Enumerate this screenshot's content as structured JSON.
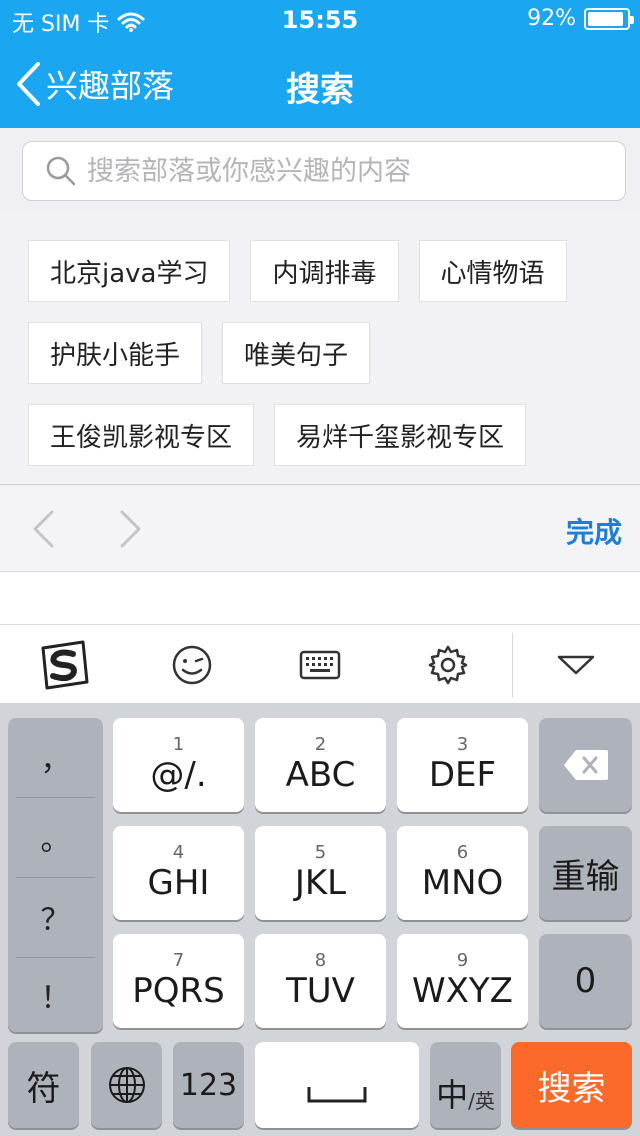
{
  "status_bar": {
    "carrier": "无 SIM 卡",
    "time": "15:55",
    "battery_text": "92%",
    "battery_level": 0.92
  },
  "nav": {
    "back_label": "兴趣部落",
    "title": "搜索"
  },
  "search": {
    "placeholder": "搜索部落或你感兴趣的内容"
  },
  "tags": [
    [
      "北京java学习",
      "内调排毒",
      "心情物语"
    ],
    [
      "护肤小能手",
      "唯美句子"
    ],
    [
      "王俊凯影视专区",
      "易烊千玺影视专区"
    ]
  ],
  "accessory": {
    "done_label": "完成"
  },
  "keyboard": {
    "punctuation": [
      "，",
      "。",
      "？",
      "！"
    ],
    "keys": [
      {
        "num": "1",
        "letters": "@/."
      },
      {
        "num": "2",
        "letters": "ABC"
      },
      {
        "num": "3",
        "letters": "DEF"
      },
      {
        "num": "4",
        "letters": "GHI"
      },
      {
        "num": "5",
        "letters": "JKL"
      },
      {
        "num": "6",
        "letters": "MNO"
      },
      {
        "num": "7",
        "letters": "PQRS"
      },
      {
        "num": "8",
        "letters": "TUV"
      },
      {
        "num": "9",
        "letters": "WXYZ"
      }
    ],
    "reinput_label": "重输",
    "zero_label": "0",
    "symbol_label": "符",
    "num_label": "123",
    "lang_main": "中",
    "lang_sub": "英",
    "search_label": "搜索"
  },
  "colors": {
    "nav_bg": "#1aa6f0",
    "done_blue": "#1d7fd8",
    "search_key": "#fc6a2b"
  }
}
